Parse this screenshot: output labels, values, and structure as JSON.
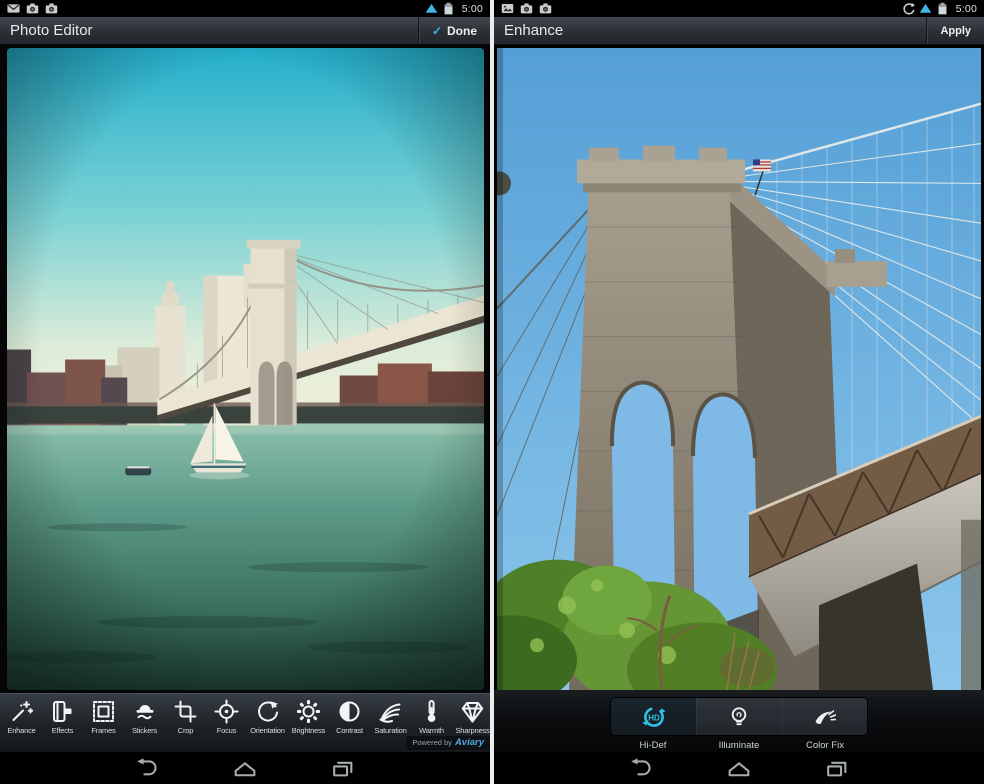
{
  "left": {
    "time": "5:00",
    "title": "Photo Editor",
    "action": "Done",
    "status_icons": [
      "email-icon",
      "camera-icon",
      "camera-icon",
      "wifi-icon",
      "battery-icon"
    ],
    "tools": [
      {
        "label": "Enhance",
        "icon": "magic-wand-icon"
      },
      {
        "label": "Effects",
        "icon": "film-roll-icon"
      },
      {
        "label": "Frames",
        "icon": "stamp-frame-icon"
      },
      {
        "label": "Stickers",
        "icon": "hat-mustache-icon"
      },
      {
        "label": "Crop",
        "icon": "crop-icon"
      },
      {
        "label": "Focus",
        "icon": "focus-target-icon"
      },
      {
        "label": "Orientation",
        "icon": "rotate-arrow-icon"
      },
      {
        "label": "Brightness",
        "icon": "sun-gear-icon"
      },
      {
        "label": "Contrast",
        "icon": "half-circle-icon"
      },
      {
        "label": "Saturation",
        "icon": "rainbow-fan-icon"
      },
      {
        "label": "Warmth",
        "icon": "thermometer-icon"
      },
      {
        "label": "Sharpness",
        "icon": "diamond-icon"
      }
    ],
    "powered_prefix": "Powered by",
    "powered_brand": "Aviary",
    "photo_alt": "Vintage-filtered photo: sailboat on teal river, Manhattan skyline and Brooklyn Bridge"
  },
  "right": {
    "time": "5:00",
    "title": "Enhance",
    "action": "Apply",
    "status_icons": [
      "gallery-icon",
      "camera-icon",
      "camera-icon",
      "sync-icon",
      "wifi-icon",
      "battery-icon"
    ],
    "options": [
      {
        "label": "Hi-Def",
        "icon": "hd-circle-icon",
        "selected": true
      },
      {
        "label": "Illuminate",
        "icon": "lightbulb-icon",
        "selected": false
      },
      {
        "label": "Color Fix",
        "icon": "color-fix-icon",
        "selected": false
      }
    ],
    "photo_alt": "Brooklyn Bridge stone tower with suspension cables, blue sky, bridge deck and green trees"
  },
  "icons": {
    "check": "✓",
    "hd_text": "HD"
  },
  "colors": {
    "accent_blue": "#36b4e6",
    "hd_cyan": "#2fc0e8",
    "wifi_blue": "#41b7e5"
  }
}
